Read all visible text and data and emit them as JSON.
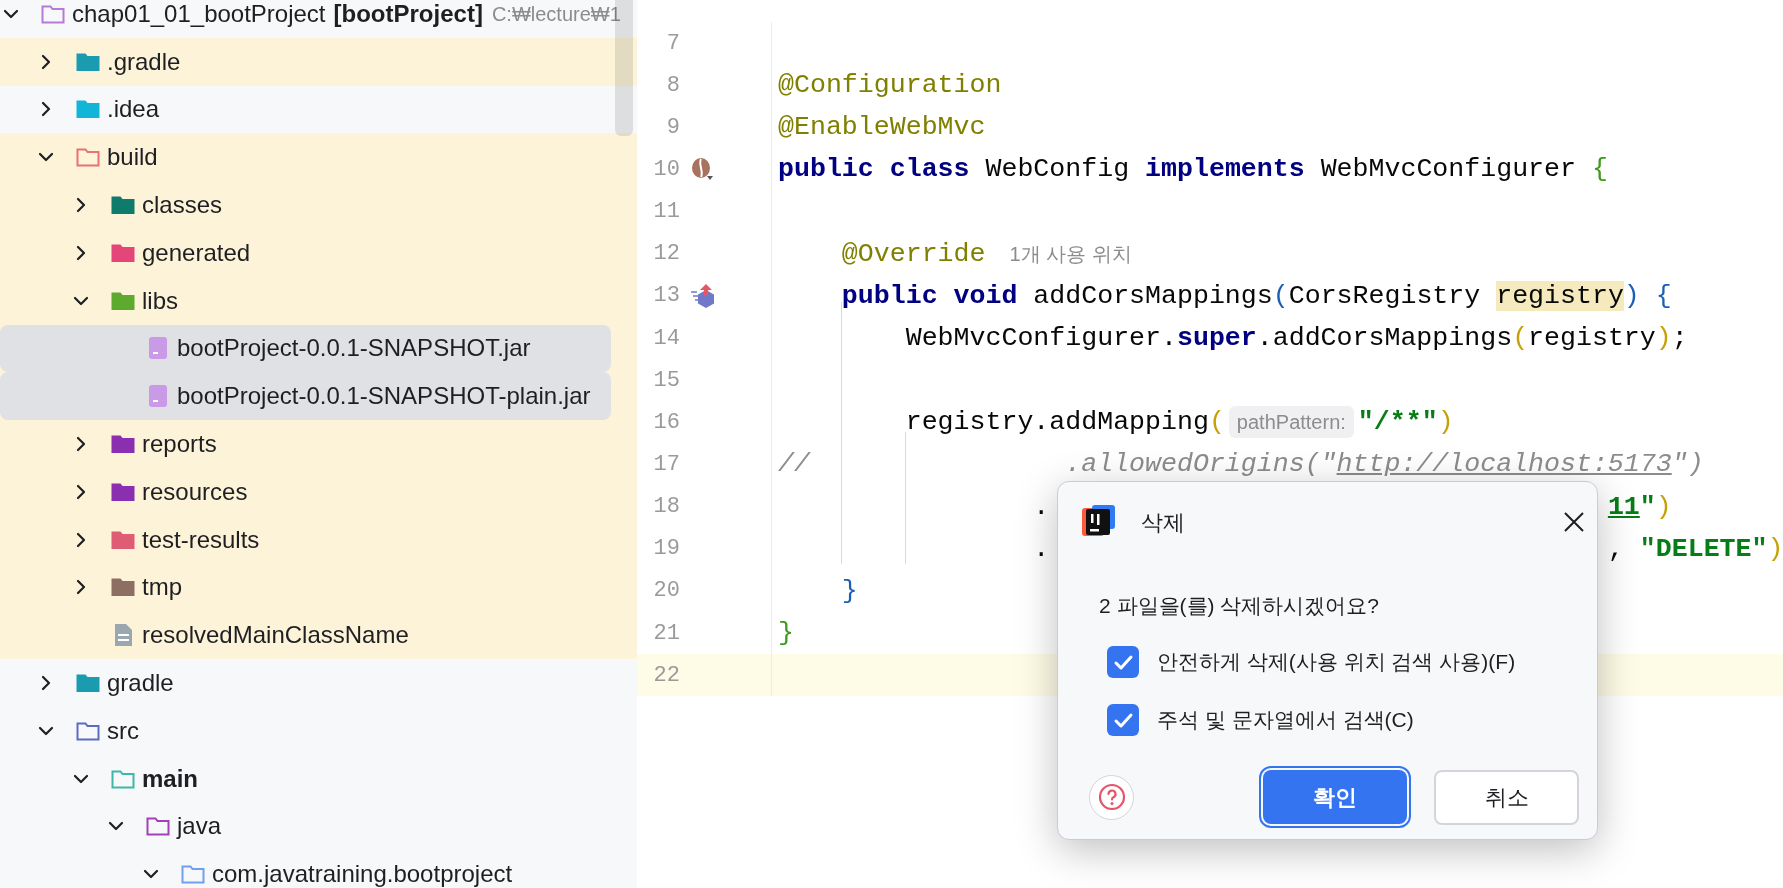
{
  "project_tree": {
    "nodes": [
      {
        "name": "chap01_01_bootProject",
        "module": "[bootProject]",
        "path": "C:₩lecture₩1",
        "kind": "module",
        "expanded": true,
        "selected": false,
        "ignored": false,
        "bold": false,
        "children": [
          {
            "name": ".gradle",
            "kind": "gradle",
            "expanded": false,
            "selected": false,
            "ignored": true,
            "bold": false
          },
          {
            "name": ".idea",
            "kind": "idea",
            "expanded": false,
            "selected": false,
            "ignored": false,
            "bold": false
          },
          {
            "name": "build",
            "kind": "excluded",
            "expanded": true,
            "selected": false,
            "ignored": true,
            "bold": false,
            "children": [
              {
                "name": "classes",
                "kind": "classes",
                "expanded": false,
                "selected": false,
                "ignored": true,
                "bold": false
              },
              {
                "name": "generated",
                "kind": "generated",
                "expanded": false,
                "selected": false,
                "ignored": true,
                "bold": false
              },
              {
                "name": "libs",
                "kind": "libs",
                "expanded": true,
                "selected": false,
                "ignored": true,
                "bold": false,
                "children": [
                  {
                    "name": "bootProject-0.0.1-SNAPSHOT.jar",
                    "kind": "jar",
                    "selected": true,
                    "ignored": true,
                    "bold": false
                  },
                  {
                    "name": "bootProject-0.0.1-SNAPSHOT-plain.jar",
                    "kind": "jar",
                    "selected": true,
                    "ignored": true,
                    "bold": false
                  }
                ]
              },
              {
                "name": "reports",
                "kind": "reports",
                "expanded": false,
                "selected": false,
                "ignored": true,
                "bold": false
              },
              {
                "name": "resources",
                "kind": "resources",
                "expanded": false,
                "selected": false,
                "ignored": true,
                "bold": false
              },
              {
                "name": "test-results",
                "kind": "results",
                "expanded": false,
                "selected": false,
                "ignored": true,
                "bold": false
              },
              {
                "name": "tmp",
                "kind": "temp",
                "expanded": false,
                "selected": false,
                "ignored": true,
                "bold": false
              },
              {
                "name": "resolvedMainClassName",
                "kind": "text",
                "selected": false,
                "ignored": true,
                "bold": false
              }
            ]
          },
          {
            "name": "gradle",
            "kind": "gradle",
            "expanded": false,
            "selected": false,
            "ignored": false,
            "bold": false
          },
          {
            "name": "src",
            "kind": "source",
            "expanded": true,
            "selected": false,
            "ignored": false,
            "bold": false,
            "children": [
              {
                "name": "main",
                "kind": "sourceset",
                "expanded": true,
                "selected": false,
                "ignored": false,
                "bold": true,
                "children": [
                  {
                    "name": "java",
                    "kind": "java",
                    "expanded": true,
                    "selected": false,
                    "ignored": false,
                    "bold": false,
                    "children": [
                      {
                        "name": "com.javatraining.bootproject",
                        "kind": "package",
                        "expanded": true,
                        "selected": false,
                        "ignored": false,
                        "bold": false
                      }
                    ]
                  }
                ]
              }
            ]
          }
        ]
      }
    ]
  },
  "editor": {
    "lines": [
      {
        "number": "7",
        "current": false
      },
      {
        "number": "8",
        "current": false,
        "segments": [
          {
            "kind": "code",
            "tokens": [
              {
                "text": "@Configuration",
                "kind": "annotation"
              }
            ]
          }
        ]
      },
      {
        "number": "9",
        "current": false,
        "segments": [
          {
            "kind": "code",
            "tokens": [
              {
                "text": "@EnableWebMvc",
                "kind": "annotation"
              }
            ]
          }
        ]
      },
      {
        "number": "10",
        "current": false,
        "gutter_icon": {
          "kind": "bean"
        },
        "segments": [
          {
            "kind": "code",
            "tokens": [
              {
                "text": "public",
                "kind": "keyword"
              },
              {
                "text": " class",
                "kind": "keyword"
              },
              {
                "text": " WebConfig ",
                "kind": "plain"
              },
              {
                "text": "implements",
                "kind": "keyword"
              },
              {
                "text": " WebMvcConfigurer ",
                "kind": "plain"
              },
              {
                "text": "{",
                "kind": "brace"
              }
            ]
          }
        ]
      },
      {
        "number": "11",
        "current": false
      },
      {
        "number": "12",
        "current": false,
        "segments": [
          {
            "kind": "code",
            "tokens": [
              {
                "text": "    @Override",
                "kind": "annotation"
              }
            ]
          },
          {
            "kind": "usages",
            "text": "1개 사용 위치"
          }
        ]
      },
      {
        "number": "13",
        "current": false,
        "gutter_icon": {
          "kind": "override"
        },
        "segments": [
          {
            "kind": "code",
            "tokens": [
              {
                "text": "    public",
                "kind": "keyword"
              },
              {
                "text": " void",
                "kind": "keyword"
              },
              {
                "text": " addCorsMappings",
                "kind": "plain"
              },
              {
                "text": "(",
                "kind": "bracket"
              },
              {
                "text": "CorsRegistry ",
                "kind": "plain"
              },
              {
                "text": "registry",
                "kind": "highlight"
              },
              {
                "text": ")",
                "kind": "bracket"
              },
              {
                "text": " {",
                "kind": "bracket"
              }
            ]
          }
        ]
      },
      {
        "number": "14",
        "current": false,
        "segments": [
          {
            "kind": "code",
            "tokens": [
              {
                "text": "        WebMvcConfigurer.",
                "kind": "plain"
              },
              {
                "text": "super",
                "kind": "keyword"
              },
              {
                "text": ".addCorsMappings",
                "kind": "plain"
              },
              {
                "text": "(",
                "kind": "paren"
              },
              {
                "text": "registry",
                "kind": "plain"
              },
              {
                "text": ")",
                "kind": "paren"
              },
              {
                "text": ";",
                "kind": "plain"
              }
            ]
          }
        ]
      },
      {
        "number": "15",
        "current": false
      },
      {
        "number": "16",
        "current": false,
        "segments": [
          {
            "kind": "code",
            "tokens": [
              {
                "text": "        registry.addMapping",
                "kind": "plain"
              },
              {
                "text": "(",
                "kind": "paren"
              }
            ]
          },
          {
            "kind": "parameter",
            "text": "pathPattern:"
          },
          {
            "kind": "code",
            "tokens": [
              {
                "text": "\"/**\"",
                "kind": "string"
              },
              {
                "text": ")",
                "kind": "paren"
              }
            ]
          }
        ]
      },
      {
        "number": "17",
        "current": false,
        "segments": [
          {
            "kind": "code",
            "tokens": [
              {
                "text": "//                .allowedOrigins(\"",
                "kind": "comment"
              },
              {
                "text": "http://localhost:5173",
                "kind": "comment-link"
              },
              {
                "text": "\")",
                "kind": "comment"
              }
            ]
          }
        ]
      },
      {
        "number": "18",
        "current": false,
        "segments": [
          {
            "kind": "code",
            "tokens": [
              {
                "text": "                .",
                "kind": "plain"
              }
            ]
          },
          {
            "kind": "code",
            "tokens": [
              {
                "text": "                                   11",
                "kind": "link"
              },
              {
                "text": "\"",
                "kind": "string"
              },
              {
                "text": ")",
                "kind": "paren"
              }
            ]
          }
        ]
      },
      {
        "number": "19",
        "current": false,
        "segments": [
          {
            "kind": "code",
            "tokens": [
              {
                "text": "                .",
                "kind": "plain"
              }
            ]
          },
          {
            "kind": "code",
            "tokens": [
              {
                "text": "                                   , ",
                "kind": "plain"
              },
              {
                "text": "\"DELETE\"",
                "kind": "string"
              },
              {
                "text": ")",
                "kind": "paren"
              }
            ]
          }
        ]
      },
      {
        "number": "20",
        "current": false,
        "segments": [
          {
            "kind": "code",
            "tokens": [
              {
                "text": "    }",
                "kind": "bracket"
              }
            ]
          }
        ]
      },
      {
        "number": "21",
        "current": false,
        "segments": [
          {
            "kind": "code",
            "tokens": [
              {
                "text": "}",
                "kind": "brace"
              }
            ]
          }
        ]
      },
      {
        "number": "22",
        "current": true
      }
    ]
  },
  "dialog": {
    "title": "삭제",
    "message": "2 파일을(를) 삭제하시겠어요?",
    "options": [
      {
        "label": "안전하게 삭제(사용 위치 검색 사용)(F)",
        "checked": true
      },
      {
        "label": "주석 및 문자열에서 검색(C)",
        "checked": true
      }
    ],
    "buttons": [
      {
        "label": "확인",
        "kind": "primary"
      },
      {
        "label": "취소",
        "kind": "secondary"
      }
    ]
  }
}
